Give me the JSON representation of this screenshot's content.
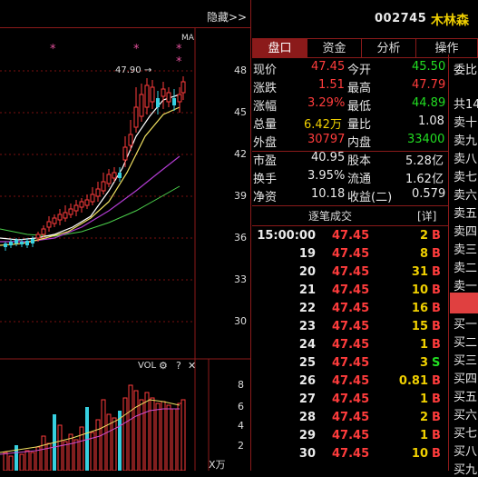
{
  "header": {
    "hide_label": "隐藏>>",
    "stock_code": "002745",
    "stock_name": "木林森"
  },
  "tabs": [
    "盘口",
    "资金",
    "分析",
    "操作"
  ],
  "chart": {
    "ma_label": "MA",
    "price_ticks": [
      "48",
      "45",
      "42",
      "39",
      "36",
      "33",
      "30"
    ],
    "high_marker": "47.90",
    "vol_label": "VOL",
    "vol_ticks": [
      "8",
      "6",
      "4",
      "2"
    ],
    "vol_unit": "X万"
  },
  "quote": {
    "rows": [
      {
        "l1": "现价",
        "v1": "47.45",
        "l2": "今开",
        "v2": "45.50"
      },
      {
        "l1": "涨跌",
        "v1": "1.51",
        "l2": "最高",
        "v2": "47.79"
      },
      {
        "l1": "涨幅",
        "v1": "3.29%",
        "l2": "最低",
        "v2": "44.89"
      },
      {
        "l1": "总量",
        "v1": "6.42万",
        "l2": "量比",
        "v2": "1.08"
      },
      {
        "l1": "外盘",
        "v1": "30797",
        "l2": "内盘",
        "v2": "33400"
      },
      {
        "l1": "市盈",
        "v1": "40.95",
        "l2": "股本",
        "v2": "5.28亿"
      },
      {
        "l1": "换手",
        "v1": "3.95%",
        "l2": "流通",
        "v2": "1.62亿"
      },
      {
        "l1": "净资",
        "v1": "10.18",
        "l2": "收益(二)",
        "v2": "0.579"
      }
    ],
    "colors": {
      "up": "#ff3c3c",
      "down": "#22dd22",
      "neutral": "#eaeaea",
      "volume": "#f0d000"
    }
  },
  "trades": {
    "title": "逐笔成交",
    "detail": "[详]",
    "rows": [
      {
        "time": "15:00:00",
        "price": "47.45",
        "vol": "2",
        "side": "B"
      },
      {
        "time": "19",
        "price": "47.45",
        "vol": "8",
        "side": "B"
      },
      {
        "time": "20",
        "price": "47.45",
        "vol": "31",
        "side": "B"
      },
      {
        "time": "21",
        "price": "47.45",
        "vol": "10",
        "side": "B"
      },
      {
        "time": "22",
        "price": "47.45",
        "vol": "16",
        "side": "B"
      },
      {
        "time": "23",
        "price": "47.45",
        "vol": "15",
        "side": "B"
      },
      {
        "time": "24",
        "price": "47.45",
        "vol": "1",
        "side": "B"
      },
      {
        "time": "25",
        "price": "47.45",
        "vol": "3",
        "side": "S"
      },
      {
        "time": "26",
        "price": "47.45",
        "vol": "0.81",
        "side": "B"
      },
      {
        "time": "27",
        "price": "47.45",
        "vol": "1",
        "side": "B"
      },
      {
        "time": "28",
        "price": "47.45",
        "vol": "2",
        "side": "B"
      },
      {
        "time": "29",
        "price": "47.45",
        "vol": "1",
        "side": "B"
      },
      {
        "time": "30",
        "price": "47.45",
        "vol": "10",
        "side": "B"
      }
    ]
  },
  "orderbook": {
    "top": [
      "委比",
      "共14"
    ],
    "sells": [
      "卖十",
      "卖九",
      "卖八",
      "卖七",
      "卖六",
      "卖五",
      "卖四",
      "卖三",
      "卖二",
      "卖一"
    ],
    "buys": [
      "买一",
      "买二",
      "买三",
      "买四",
      "买五",
      "买六",
      "买七",
      "买八",
      "买九"
    ]
  }
}
